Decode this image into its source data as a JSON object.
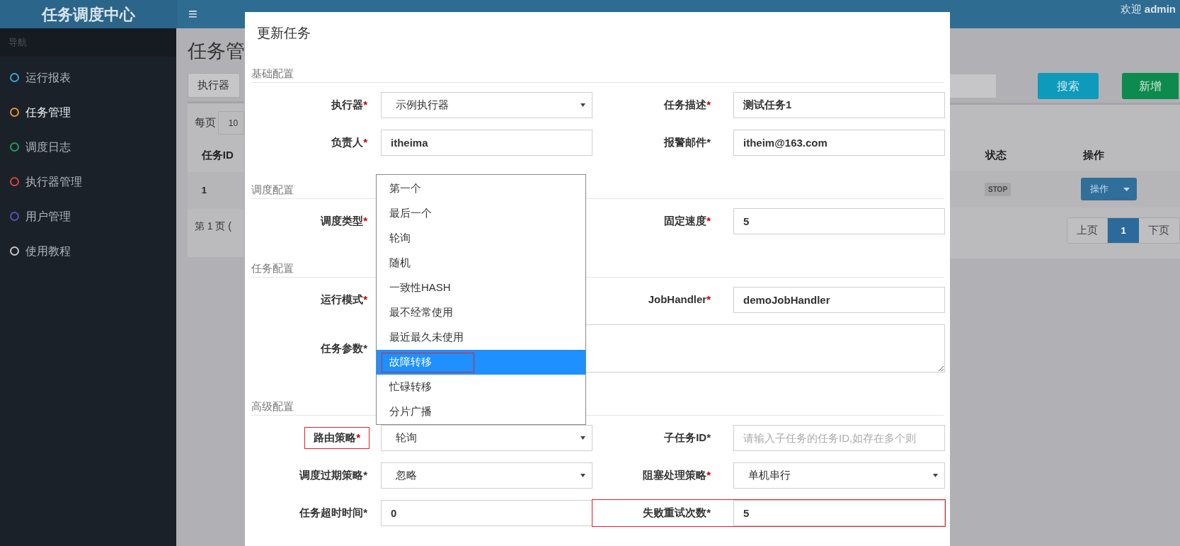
{
  "header": {
    "logo": "任务调度中心",
    "menu_toggle": "≡",
    "welcome": "欢迎 **admin**"
  },
  "sidebar": {
    "heading": "导航",
    "items": [
      {
        "label": "运行报表",
        "color": "#3ba5d6",
        "selected": false
      },
      {
        "label": "任务管理",
        "color": "#e8922e",
        "selected": true
      },
      {
        "label": "调度日志",
        "color": "#1e9e58",
        "selected": false
      },
      {
        "label": "执行器管理",
        "color": "#d9443a",
        "selected": false
      },
      {
        "label": "用户管理",
        "color": "#5a52b0",
        "selected": false
      },
      {
        "label": "使用教程",
        "color": "#c8c8c8",
        "selected": false
      }
    ]
  },
  "page": {
    "title": "任务管",
    "filter_button": "执行器",
    "search_button": "搜索",
    "add_button": "新增",
    "page_size_label": "每页",
    "page_size": "10",
    "columns": [
      "任务ID",
      "状态",
      "操作"
    ],
    "rows": [
      {
        "id": "1",
        "status": "STOP",
        "action": "操作"
      }
    ],
    "page_info": "第 1 页 (",
    "pagination": [
      {
        "label": "上页",
        "selected": false
      },
      {
        "label": "1",
        "selected": true
      },
      {
        "label": "下页",
        "selected": false
      }
    ]
  },
  "modal": {
    "title": "更新任务",
    "required_mark": "*",
    "sections": [
      {
        "title": "基础配置",
        "rows": [
          [
            {
              "label": "执行器",
              "red_mark": true,
              "control": {
                "kind": "select",
                "value": "示例执行器"
              }
            },
            {
              "label": "任务描述",
              "red_mark": true,
              "control": {
                "kind": "input",
                "value": "测试任务1"
              }
            }
          ],
          [
            {
              "label": "负责人",
              "red_mark": true,
              "control": {
                "kind": "input",
                "value": "itheima"
              }
            },
            {
              "label": "报警邮件",
              "red_mark": false,
              "control": {
                "kind": "input",
                "value": "itheim@163.com"
              }
            }
          ]
        ]
      },
      {
        "title": "调度配置",
        "rows": [
          [
            {
              "label": "调度类型",
              "red_mark": true
            },
            {
              "label": "固定速度",
              "red_mark": true,
              "control": {
                "kind": "input",
                "value": "5"
              }
            }
          ]
        ]
      },
      {
        "title": "任务配置",
        "rows": [
          [
            {
              "label": "运行模式",
              "red_mark": true
            },
            {
              "label": "JobHandler",
              "red_mark": true,
              "control": {
                "kind": "input",
                "value": "demoJobHandler"
              }
            }
          ],
          [
            {
              "label": "任务参数",
              "red_mark": false,
              "control": {
                "kind": "textarea"
              }
            }
          ]
        ]
      },
      {
        "title": "高级配置",
        "rows": [
          [
            {
              "label": "路由策略",
              "red_mark": true,
              "label_highlighted": true,
              "control": {
                "kind": "select",
                "value": "轮询"
              }
            },
            {
              "label": "子任务ID",
              "red_mark": false,
              "control": {
                "kind": "input",
                "placeholder": "请输入子任务的任务ID,如存在多个则"
              }
            }
          ],
          [
            {
              "label": "调度过期策略",
              "red_mark": false,
              "control": {
                "kind": "select",
                "value": "忽略"
              }
            },
            {
              "label": "阻塞处理策略",
              "red_mark": true,
              "control": {
                "kind": "select",
                "value": "单机串行"
              }
            }
          ],
          [
            {
              "label": "任务超时时间",
              "red_mark": false,
              "control": {
                "kind": "input",
                "value": "0"
              }
            },
            {
              "label": "失败重试次数",
              "red_mark": false,
              "row_highlighted": true,
              "control": {
                "kind": "input",
                "value": "5"
              }
            }
          ]
        ]
      }
    ],
    "dropdown": {
      "options": [
        {
          "label": "第一个",
          "selected": false
        },
        {
          "label": "最后一个",
          "selected": false
        },
        {
          "label": "轮询",
          "selected": false
        },
        {
          "label": "随机",
          "selected": false
        },
        {
          "label": "一致性HASH",
          "selected": false
        },
        {
          "label": "最不经常使用",
          "selected": false
        },
        {
          "label": "最近最久未使用",
          "selected": false
        },
        {
          "label": "故障转移",
          "selected": true,
          "highlighted": true
        },
        {
          "label": "忙碌转移",
          "selected": false
        },
        {
          "label": "分片广播",
          "selected": false
        }
      ]
    }
  }
}
